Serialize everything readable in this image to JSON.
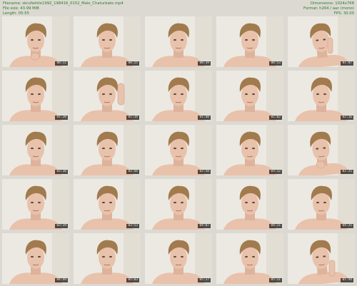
{
  "header": {
    "filename_label": "Filename:",
    "filename": "skrufwhite1992_198416_0152_Male_Chaturbate.mp4",
    "filesize_label": "File size:",
    "filesize": "43.99 MiB",
    "length_label": "Length:",
    "length": "05:55",
    "dimensions_label": "Dimensions:",
    "dimensions": "1024x768",
    "format_label": "Format:",
    "format": "h264 / aac (mono)",
    "fps_label": "FPS:",
    "fps": "30.00"
  },
  "thumbnails": [
    {
      "time": "00:11",
      "pose": "neutral",
      "hand": "chin"
    },
    {
      "time": "00:25",
      "pose": "neutral",
      "hand": "none"
    },
    {
      "time": "00:39",
      "pose": "neutral",
      "hand": "none"
    },
    {
      "time": "00:53",
      "pose": "neutral",
      "hand": "none"
    },
    {
      "time": "01:07",
      "pose": "tilt",
      "hand": "nose"
    },
    {
      "time": "01:20",
      "pose": "neutral",
      "hand": "none"
    },
    {
      "time": "01:34",
      "pose": "neutral",
      "hand": "raised"
    },
    {
      "time": "01:48",
      "pose": "neutral",
      "hand": "none"
    },
    {
      "time": "02:02",
      "pose": "neutral",
      "hand": "none"
    },
    {
      "time": "02:16",
      "pose": "neutral",
      "hand": "none"
    },
    {
      "time": "02:30",
      "pose": "neutral",
      "hand": "none"
    },
    {
      "time": "02:44",
      "pose": "neutral",
      "hand": "none"
    },
    {
      "time": "02:58",
      "pose": "neutral",
      "hand": "none"
    },
    {
      "time": "03:12",
      "pose": "neutral",
      "hand": "none"
    },
    {
      "time": "03:25",
      "pose": "tilt",
      "hand": "chin"
    },
    {
      "time": "03:39",
      "pose": "neutral",
      "hand": "none"
    },
    {
      "time": "03:53",
      "pose": "neutral",
      "hand": "none"
    },
    {
      "time": "04:07",
      "pose": "neutral",
      "hand": "none"
    },
    {
      "time": "04:21",
      "pose": "neutral",
      "hand": "none"
    },
    {
      "time": "04:35",
      "pose": "neutral",
      "hand": "none"
    },
    {
      "time": "04:49",
      "pose": "neutral",
      "hand": "none"
    },
    {
      "time": "05:03",
      "pose": "neutral",
      "hand": "none"
    },
    {
      "time": "05:17",
      "pose": "neutral",
      "hand": "none"
    },
    {
      "time": "05:31",
      "pose": "neutral",
      "hand": "none"
    },
    {
      "time": "05:44",
      "pose": "tilt",
      "hand": "cheek"
    }
  ],
  "colors": {
    "background": "#dcd9d2",
    "header_text": "#2a7a2a",
    "skin": "#e9c2ac",
    "hair": "#a17a4e"
  }
}
